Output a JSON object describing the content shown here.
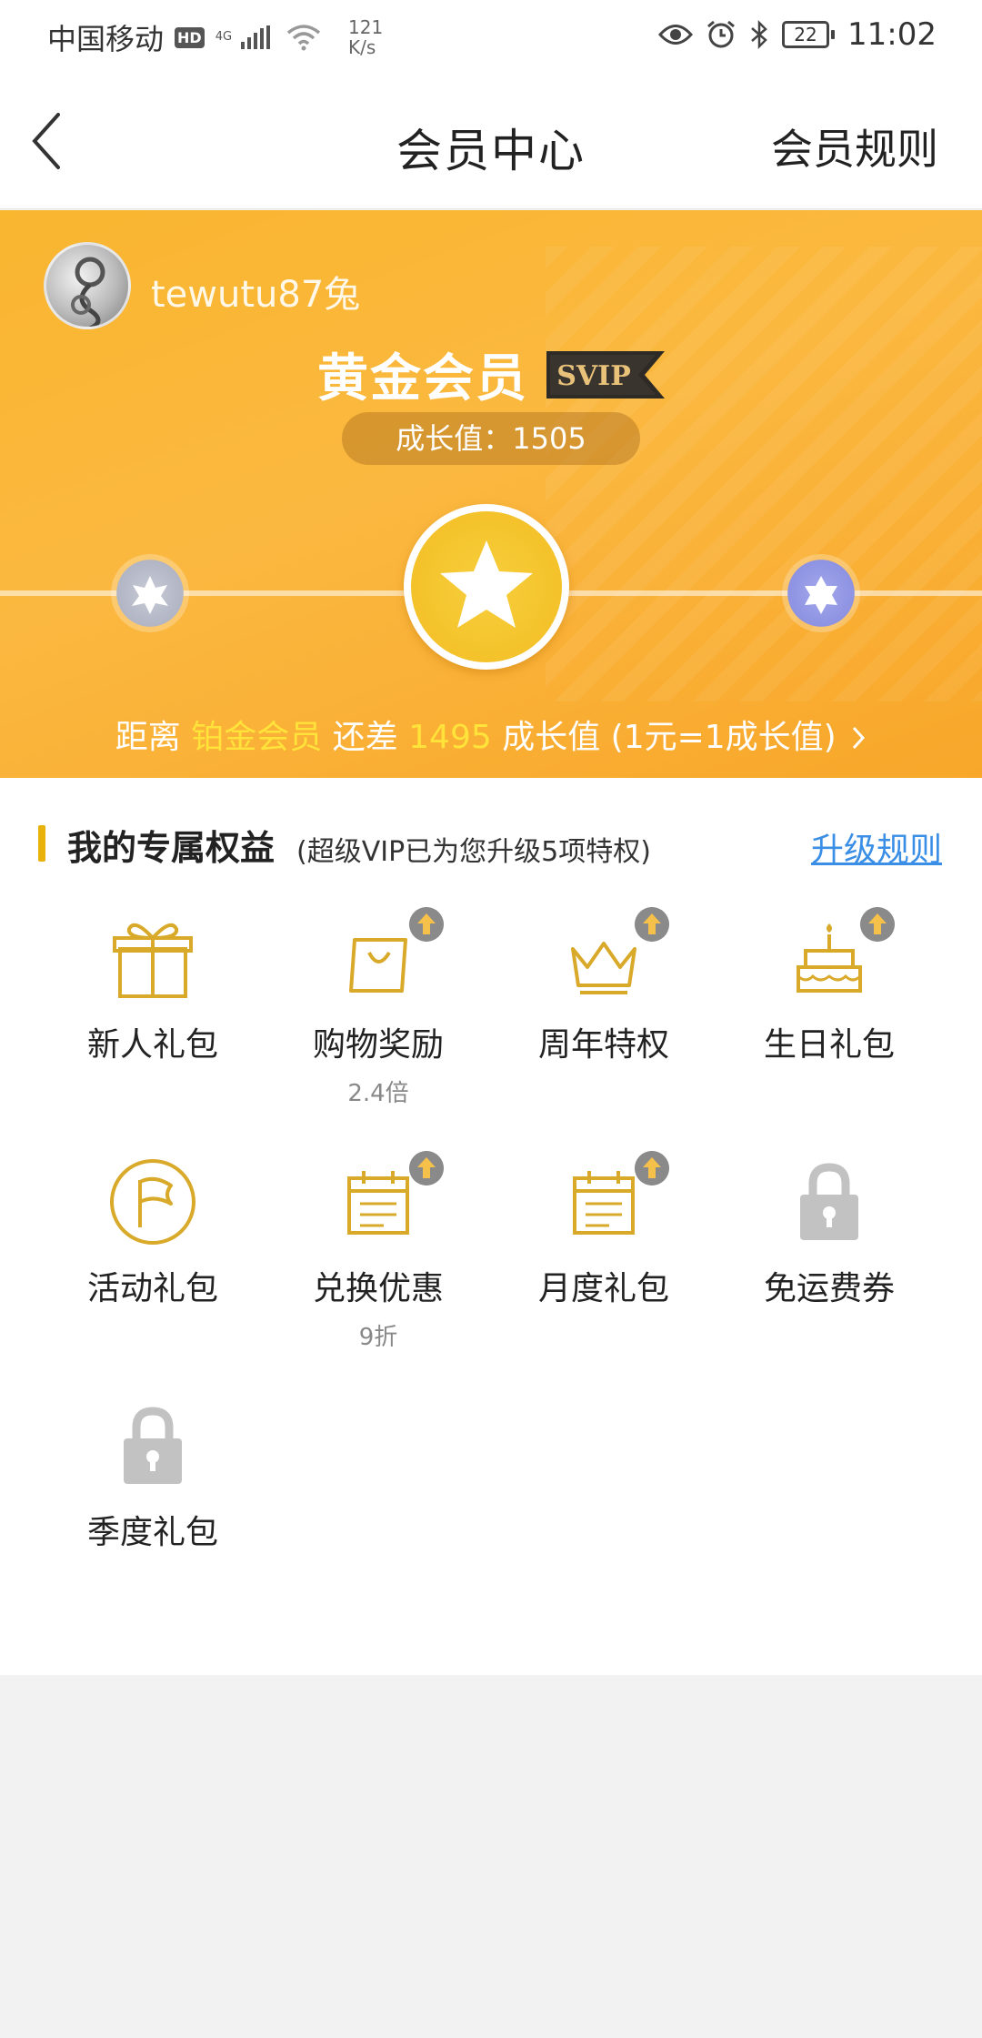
{
  "status_bar": {
    "carrier": "中国移动",
    "hd": "HD",
    "net_type": "4G",
    "speed_value": "121",
    "speed_unit": "K/s",
    "battery": "22",
    "time": "11:02"
  },
  "header": {
    "title": "会员中心",
    "rules_label": "会员规则"
  },
  "profile": {
    "username": "tewutu87兔",
    "level": "黄金会员",
    "badge": "SVIP",
    "growth_label": "成长值：1505",
    "progress": {
      "prefix": "距离 ",
      "next_level": "铂金会员",
      "mid": " 还差 ",
      "remaining": "1495",
      "suffix": " 成长值 (1元=1成长值)"
    }
  },
  "benefits": {
    "title": "我的专属权益",
    "subtitle": "(超级VIP已为您升级5项特权)",
    "upgrade_rules": "升级规则",
    "items": [
      {
        "label": "新人礼包",
        "sub": "",
        "icon": "gift-icon",
        "upgraded": false,
        "locked": false
      },
      {
        "label": "购物奖励",
        "sub": "2.4倍",
        "icon": "shopping-bag-icon",
        "upgraded": true,
        "locked": false
      },
      {
        "label": "周年特权",
        "sub": "",
        "icon": "crown-icon",
        "upgraded": true,
        "locked": false
      },
      {
        "label": "生日礼包",
        "sub": "",
        "icon": "cake-icon",
        "upgraded": true,
        "locked": false
      },
      {
        "label": "活动礼包",
        "sub": "",
        "icon": "flag-icon",
        "upgraded": false,
        "locked": false
      },
      {
        "label": "兑换优惠",
        "sub": "9折",
        "icon": "calendar-icon",
        "upgraded": true,
        "locked": false
      },
      {
        "label": "月度礼包",
        "sub": "",
        "icon": "calendar-icon",
        "upgraded": true,
        "locked": false
      },
      {
        "label": "免运费券",
        "sub": "",
        "icon": "lock-icon",
        "upgraded": false,
        "locked": true
      },
      {
        "label": "季度礼包",
        "sub": "",
        "icon": "lock-icon",
        "upgraded": false,
        "locked": true
      }
    ]
  },
  "colors": {
    "banner": "#f9b62f",
    "gold_icon": "#d9a92a",
    "highlight": "#ffe23a",
    "link": "#3a8ee6",
    "locked": "#c2c2c2"
  }
}
